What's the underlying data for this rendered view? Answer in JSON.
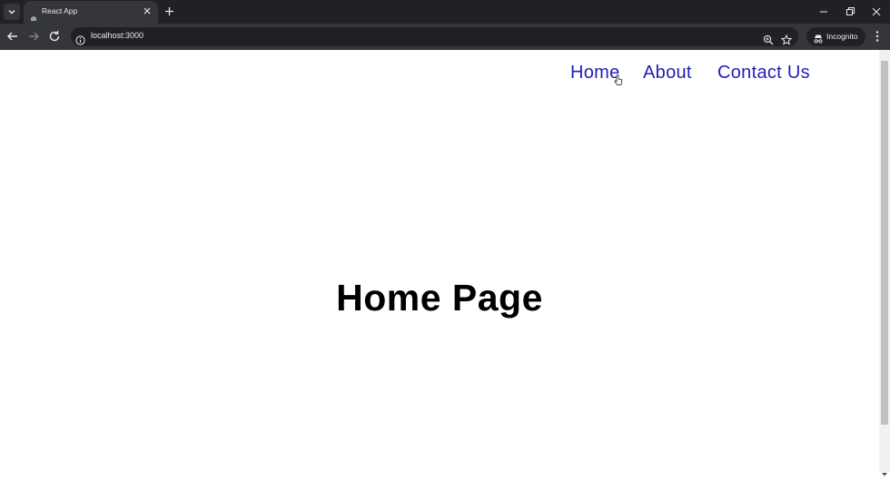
{
  "browser": {
    "tab": {
      "title": "React App"
    },
    "address_bar": {
      "url": "localhost:3000"
    },
    "profile": {
      "label": "Incognito"
    },
    "icons": [
      "tab-list-icon",
      "app-favicon-icon",
      "close-tab-icon",
      "new-tab-icon",
      "minimize-icon",
      "restore-icon",
      "close-window-icon",
      "back-icon",
      "forward-icon",
      "reload-icon",
      "site-info-icon",
      "zoom-icon",
      "bookmark-star-icon",
      "incognito-icon",
      "more-menu-icon"
    ]
  },
  "page": {
    "nav": {
      "links": [
        {
          "label": "Home"
        },
        {
          "label": "About"
        },
        {
          "label": "Contact Us"
        }
      ]
    },
    "heading": "Home Page"
  },
  "colors": {
    "nav_link": "#1f1fb8",
    "heading": "#000000",
    "tabbar_bg": "#202124",
    "toolbar_bg": "#35363a"
  }
}
